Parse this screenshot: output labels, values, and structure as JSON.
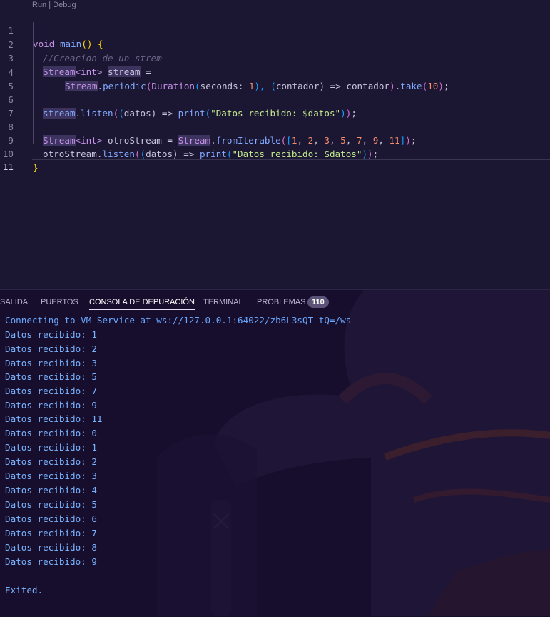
{
  "editor": {
    "codelens": "Run | Debug",
    "lines": [
      {
        "n": "1"
      },
      {
        "n": "2"
      },
      {
        "n": "3"
      },
      {
        "n": "4"
      },
      {
        "n": "5"
      },
      {
        "n": "6"
      },
      {
        "n": "7"
      },
      {
        "n": "8"
      },
      {
        "n": "9"
      },
      {
        "n": "10"
      },
      {
        "n": "11"
      }
    ],
    "code": {
      "l1_void": "void",
      "l1_main": "main",
      "l1_rest": "() {",
      "l2_comment": "//Creacion de un strem",
      "l3_type": "Stream",
      "l3_generic": "<int>",
      "l3_var": "stream",
      "l3_eq": " =",
      "l4_cls": "Stream",
      "l4_dot": ".",
      "l4_fn": "periodic",
      "l4_p1": "(",
      "l4_dur": "Duration",
      "l4_p2": "(",
      "l4_named": "seconds: ",
      "l4_one": "1",
      "l4_p3": "), ",
      "l4_p4": "(",
      "l4_param": "contador",
      "l4_p5": ") => contador",
      "l4_p6": ")",
      "l4_dot2": ".",
      "l4_take": "take",
      "l4_p7": "(",
      "l4_ten": "10",
      "l4_p8": ")",
      "l4_end": ";",
      "l6_var": "stream",
      "l6_dot": ".",
      "l6_fn": "listen",
      "l6_a": "(",
      "l6_b": "(",
      "l6_param": "datos",
      "l6_c": ") => ",
      "l6_print": "print",
      "l6_d": "(",
      "l6_str": "\"Datos recibido: $datos\"",
      "l6_e": ")",
      "l6_f": ")",
      "l6_end": ";",
      "l8_type": "Stream",
      "l8_generic": "<int>",
      "l8_var": " otroStream = ",
      "l8_cls": "Stream",
      "l8_dot": ".",
      "l8_fn": "fromIterable",
      "l8_a": "(",
      "l8_b": "[",
      "l8_nums": [
        "1",
        "2",
        "3",
        "5",
        "7",
        "9",
        "11"
      ],
      "l8_c": "]",
      "l8_d": ")",
      "l8_end": ";",
      "l9_var": "otroStream",
      "l9_dot": ".",
      "l9_fn": "listen",
      "l9_a": "(",
      "l9_b": "(",
      "l9_param": "datos",
      "l9_c": ") => ",
      "l9_print": "print",
      "l9_d": "(",
      "l9_str": "\"Datos recibido: $datos\"",
      "l9_e": ")",
      "l9_f": ")",
      "l9_end": ";",
      "l10": "}"
    }
  },
  "panel": {
    "tabs": [
      "SALIDA",
      "PUERTOS",
      "CONSOLA DE DEPURACIÓN",
      "TERMINAL",
      "PROBLEMAS"
    ],
    "problems_count": "110",
    "output": [
      "Connecting to VM Service at ws://127.0.0.1:64022/zb6L3sQT-tQ=/ws",
      "Datos recibido: 1",
      "Datos recibido: 2",
      "Datos recibido: 3",
      "Datos recibido: 5",
      "Datos recibido: 7",
      "Datos recibido: 9",
      "Datos recibido: 11",
      "Datos recibido: 0",
      "Datos recibido: 1",
      "Datos recibido: 2",
      "Datos recibido: 3",
      "Datos recibido: 4",
      "Datos recibido: 5",
      "Datos recibido: 6",
      "Datos recibido: 7",
      "Datos recibido: 8",
      "Datos recibido: 9",
      "",
      "Exited."
    ]
  },
  "colors": {
    "background": "#1b1732",
    "keyword": "#c792ea",
    "function": "#82aaff",
    "string": "#c3e88d",
    "number": "#f78c6c",
    "console_text": "#7ab4ff"
  }
}
